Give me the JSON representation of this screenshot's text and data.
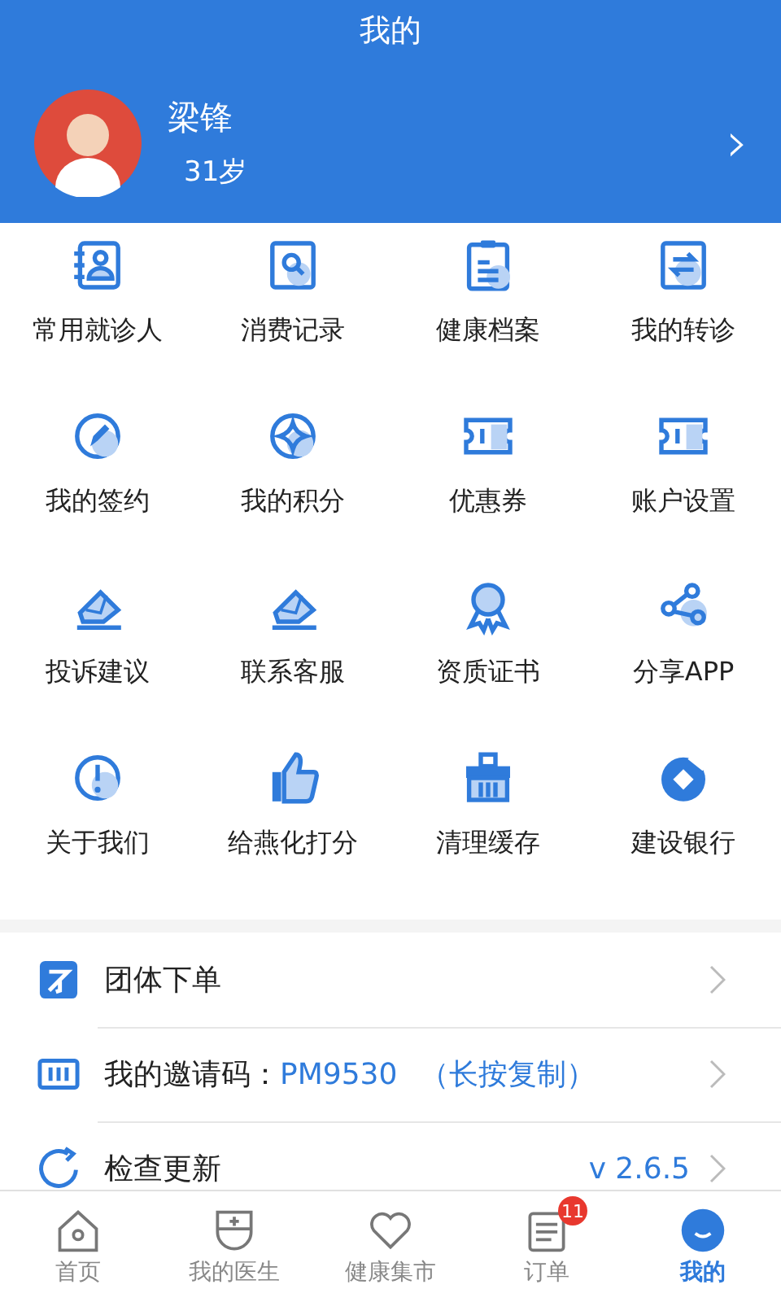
{
  "header": {
    "title": "我的"
  },
  "profile": {
    "name": "梁锋",
    "age": "31岁",
    "chevron": "›"
  },
  "menu_grid": [
    {
      "label": "常用就诊人"
    },
    {
      "label": "消费记录"
    },
    {
      "label": "健康档案"
    },
    {
      "label": "我的转诊"
    },
    {
      "label": "我的签约"
    },
    {
      "label": "我的积分"
    },
    {
      "label": "优惠券"
    },
    {
      "label": "账户设置"
    },
    {
      "label": "投诉建议"
    },
    {
      "label": "联系客服"
    },
    {
      "label": "资质证书"
    },
    {
      "label": "分享APP"
    },
    {
      "label": "关于我们"
    },
    {
      "label": "给燕化打分"
    },
    {
      "label": "清理缓存"
    },
    {
      "label": "建设银行"
    }
  ],
  "list": [
    {
      "label": "团体下单"
    },
    {
      "label": "我的邀请码：",
      "value": "PM9530",
      "note": "（长按复制）"
    },
    {
      "label": "检查更新",
      "value": "v 2.6.5"
    }
  ],
  "tab_bar": [
    {
      "label": "首页",
      "selected": false
    },
    {
      "label": "我的医生",
      "selected": false
    },
    {
      "label": "健康集市",
      "selected": false
    },
    {
      "label": "订单",
      "selected": false,
      "badge": "11"
    },
    {
      "label": "我的",
      "selected": true
    }
  ]
}
